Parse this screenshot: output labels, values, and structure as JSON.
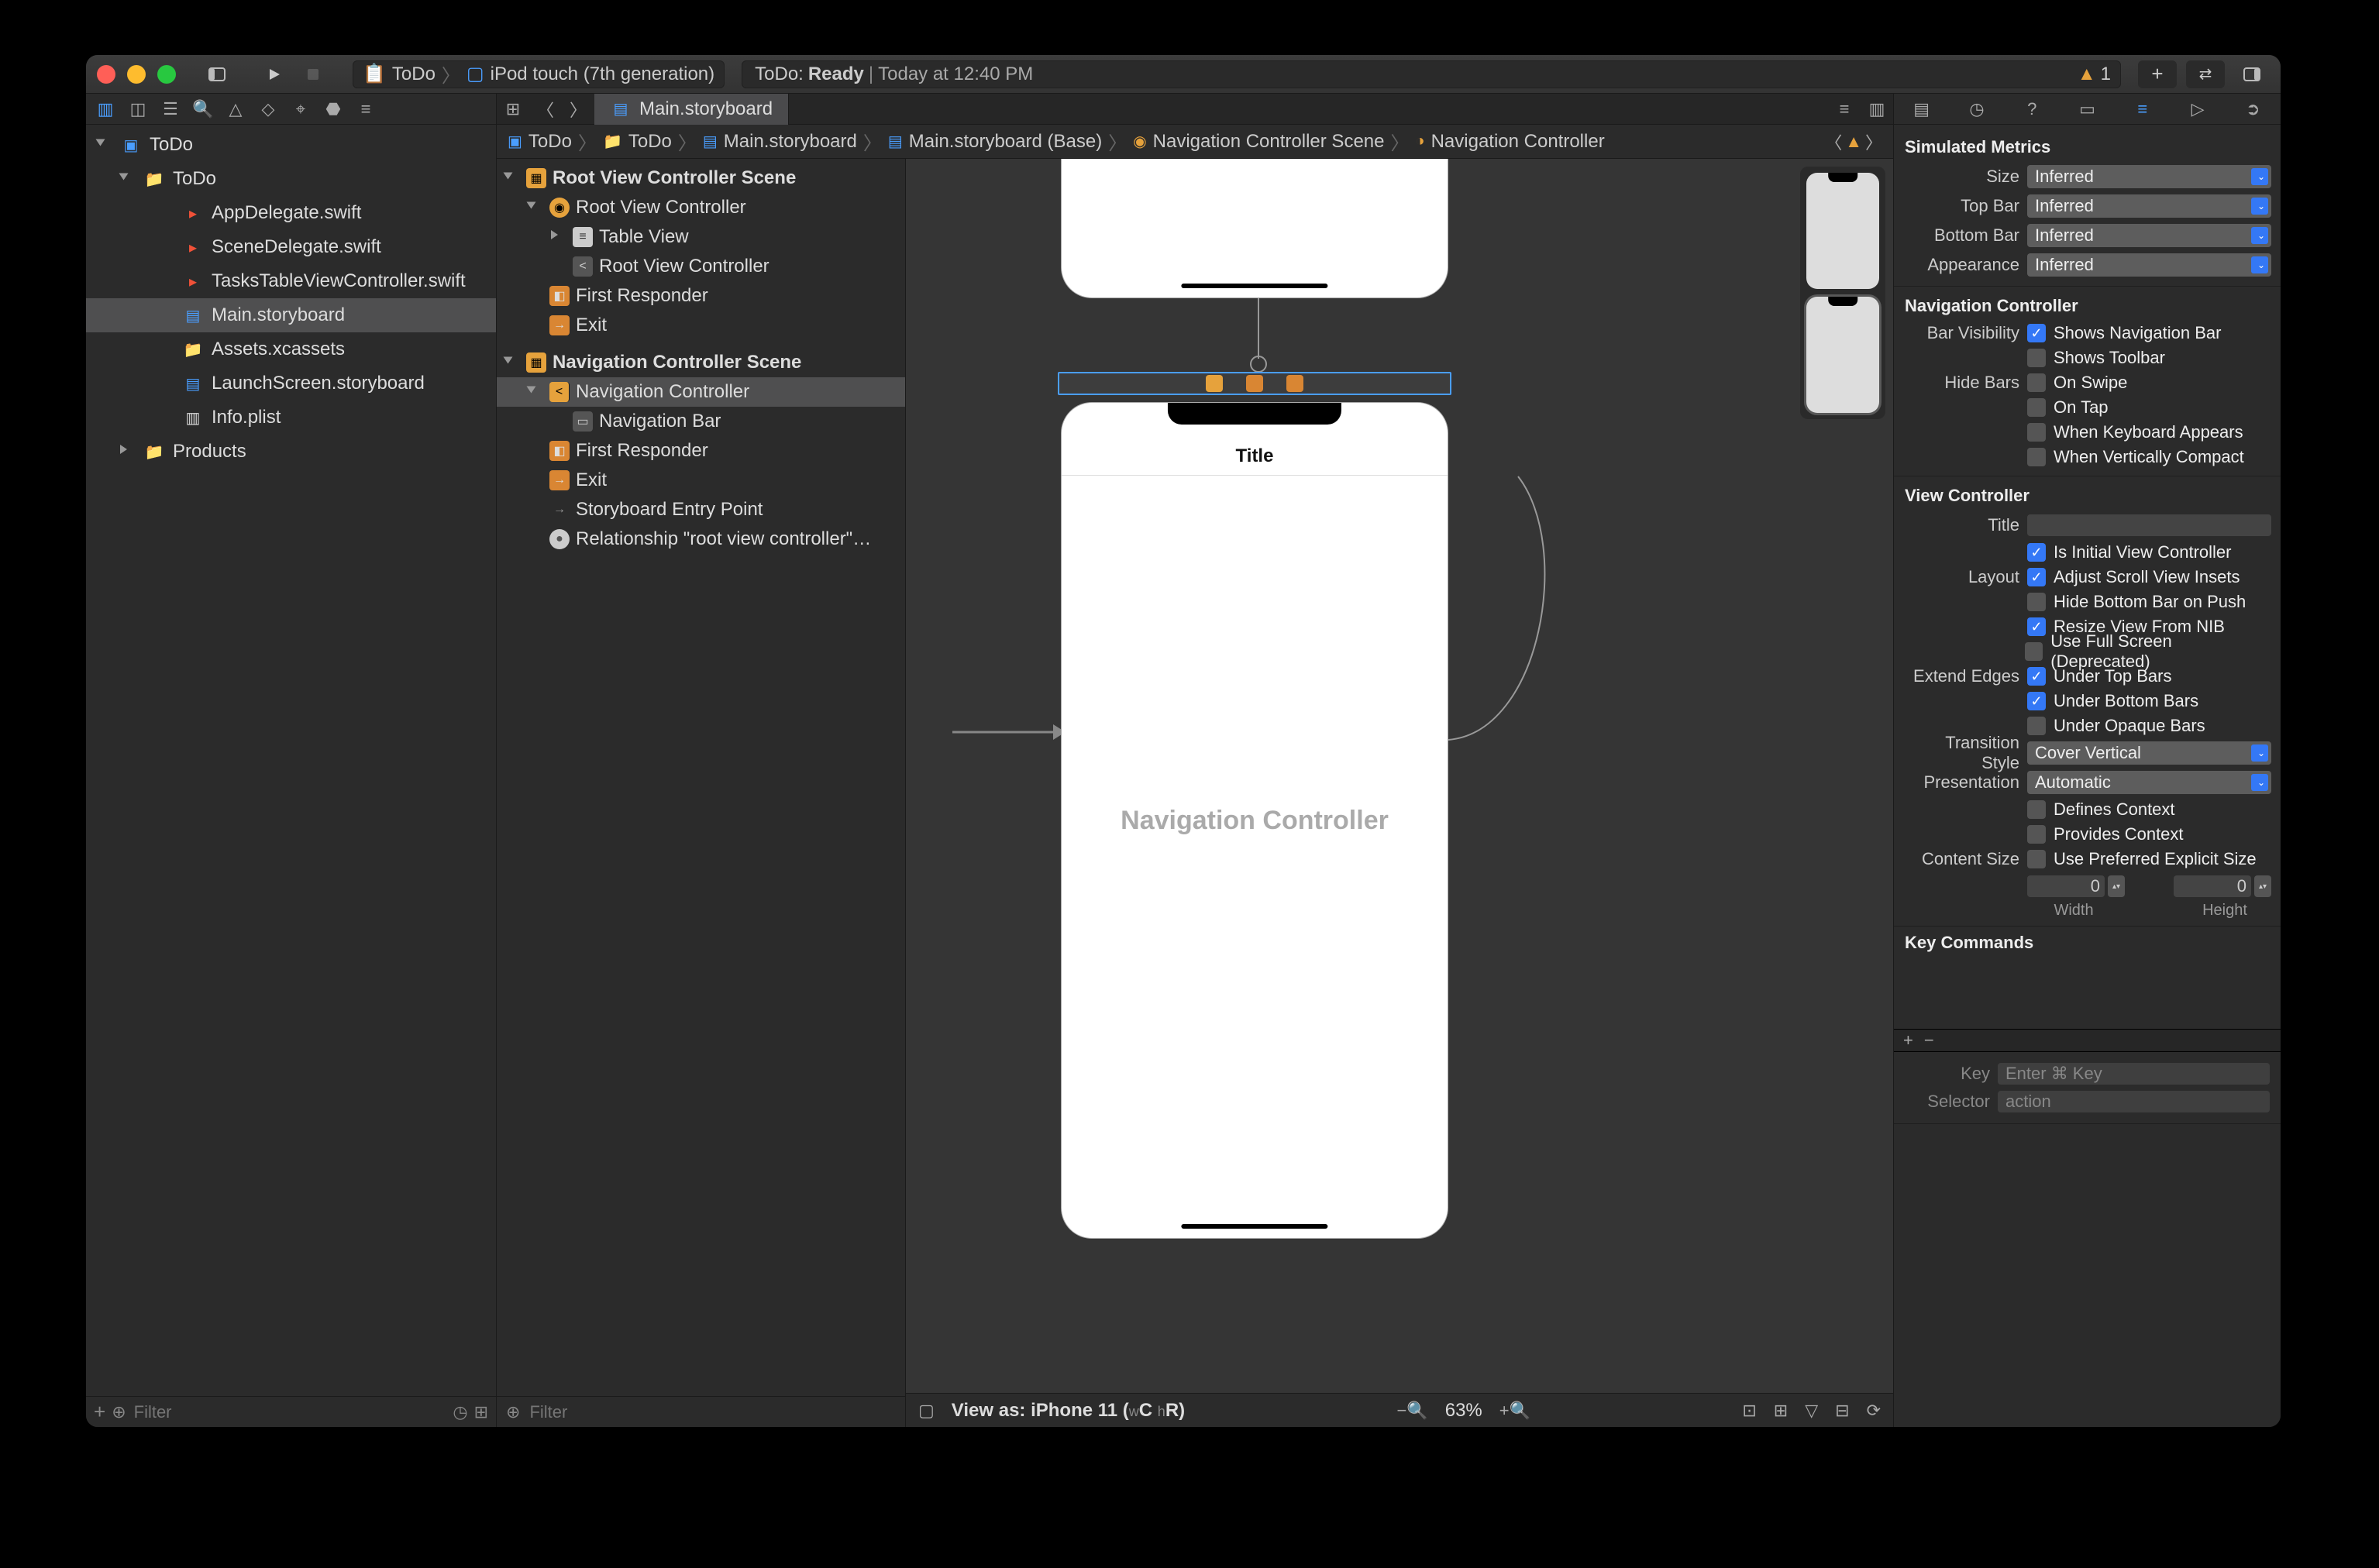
{
  "toolbar": {
    "scheme_app": "ToDo",
    "scheme_device": "iPod touch (7th generation)",
    "status_prefix": "ToDo:",
    "status_state": "Ready",
    "status_time": "Today at 12:40 PM",
    "warn_count": "1"
  },
  "navigator": {
    "filter_placeholder": "Filter",
    "tree": {
      "project": "ToDo",
      "group": "ToDo",
      "files": [
        "AppDelegate.swift",
        "SceneDelegate.swift",
        "TasksTableViewController.swift",
        "Main.storyboard",
        "Assets.xcassets",
        "LaunchScreen.storyboard",
        "Info.plist"
      ],
      "products": "Products"
    }
  },
  "editor": {
    "tab": "Main.storyboard",
    "jumpbar": [
      "ToDo",
      "ToDo",
      "Main.storyboard",
      "Main.storyboard (Base)",
      "Navigation Controller Scene",
      "Navigation Controller"
    ]
  },
  "outline": {
    "filter_placeholder": "Filter",
    "scenes": [
      {
        "name": "Root View Controller Scene",
        "children": [
          {
            "name": "Root View Controller",
            "children": [
              {
                "name": "Table View",
                "type": "table"
              },
              {
                "name": "Root View Controller",
                "type": "navitem"
              }
            ]
          },
          {
            "name": "First Responder",
            "type": "first"
          },
          {
            "name": "Exit",
            "type": "exit"
          }
        ]
      },
      {
        "name": "Navigation Controller Scene",
        "children": [
          {
            "name": "Navigation Controller",
            "children": [
              {
                "name": "Navigation Bar",
                "type": "navbar"
              }
            ]
          },
          {
            "name": "First Responder",
            "type": "first"
          },
          {
            "name": "Exit",
            "type": "exit"
          },
          {
            "name": "Storyboard Entry Point",
            "type": "arrow"
          },
          {
            "name": "Relationship \"root view controller\"…",
            "type": "rel"
          }
        ]
      }
    ]
  },
  "canvas": {
    "nav_title": "Title",
    "nav_body": "Navigation Controller",
    "bottom_label": "View as: iPhone 11 (",
    "bottom_wC": "C",
    "bottom_hR": "R",
    "bottom_close": ")",
    "zoom": "63%"
  },
  "inspector": {
    "sections": {
      "simulated": {
        "title": "Simulated Metrics",
        "size_label": "Size",
        "size": "Inferred",
        "top_label": "Top Bar",
        "top": "Inferred",
        "bottom_label": "Bottom Bar",
        "bottom": "Inferred",
        "appearance_label": "Appearance",
        "appearance": "Inferred"
      },
      "navc": {
        "title": "Navigation Controller",
        "bar_vis_label": "Bar Visibility",
        "shows_nav": "Shows Navigation Bar",
        "shows_toolbar": "Shows Toolbar",
        "hide_label": "Hide Bars",
        "on_swipe": "On Swipe",
        "on_tap": "On Tap",
        "kb": "When Keyboard Appears",
        "compact": "When Vertically Compact"
      },
      "vc": {
        "title": "View Controller",
        "title_label": "Title",
        "title_value": "",
        "initial": "Is Initial View Controller",
        "layout_label": "Layout",
        "adjust": "Adjust Scroll View Insets",
        "hide_bottom": "Hide Bottom Bar on Push",
        "resize": "Resize View From NIB",
        "full": "Use Full Screen (Deprecated)",
        "extend_label": "Extend Edges",
        "under_top": "Under Top Bars",
        "under_bottom": "Under Bottom Bars",
        "under_opaque": "Under Opaque Bars",
        "trans_label": "Transition Style",
        "trans": "Cover Vertical",
        "pres_label": "Presentation",
        "pres": "Automatic",
        "defines": "Defines Context",
        "provides": "Provides Context",
        "content_label": "Content Size",
        "use_pref": "Use Preferred Explicit Size",
        "width": "0",
        "height": "0",
        "width_label": "Width",
        "height_label": "Height"
      },
      "kc": {
        "title": "Key Commands",
        "key_label": "Key",
        "key_placeholder": "Enter ⌘ Key",
        "sel_label": "Selector",
        "sel_placeholder": "action"
      }
    }
  }
}
